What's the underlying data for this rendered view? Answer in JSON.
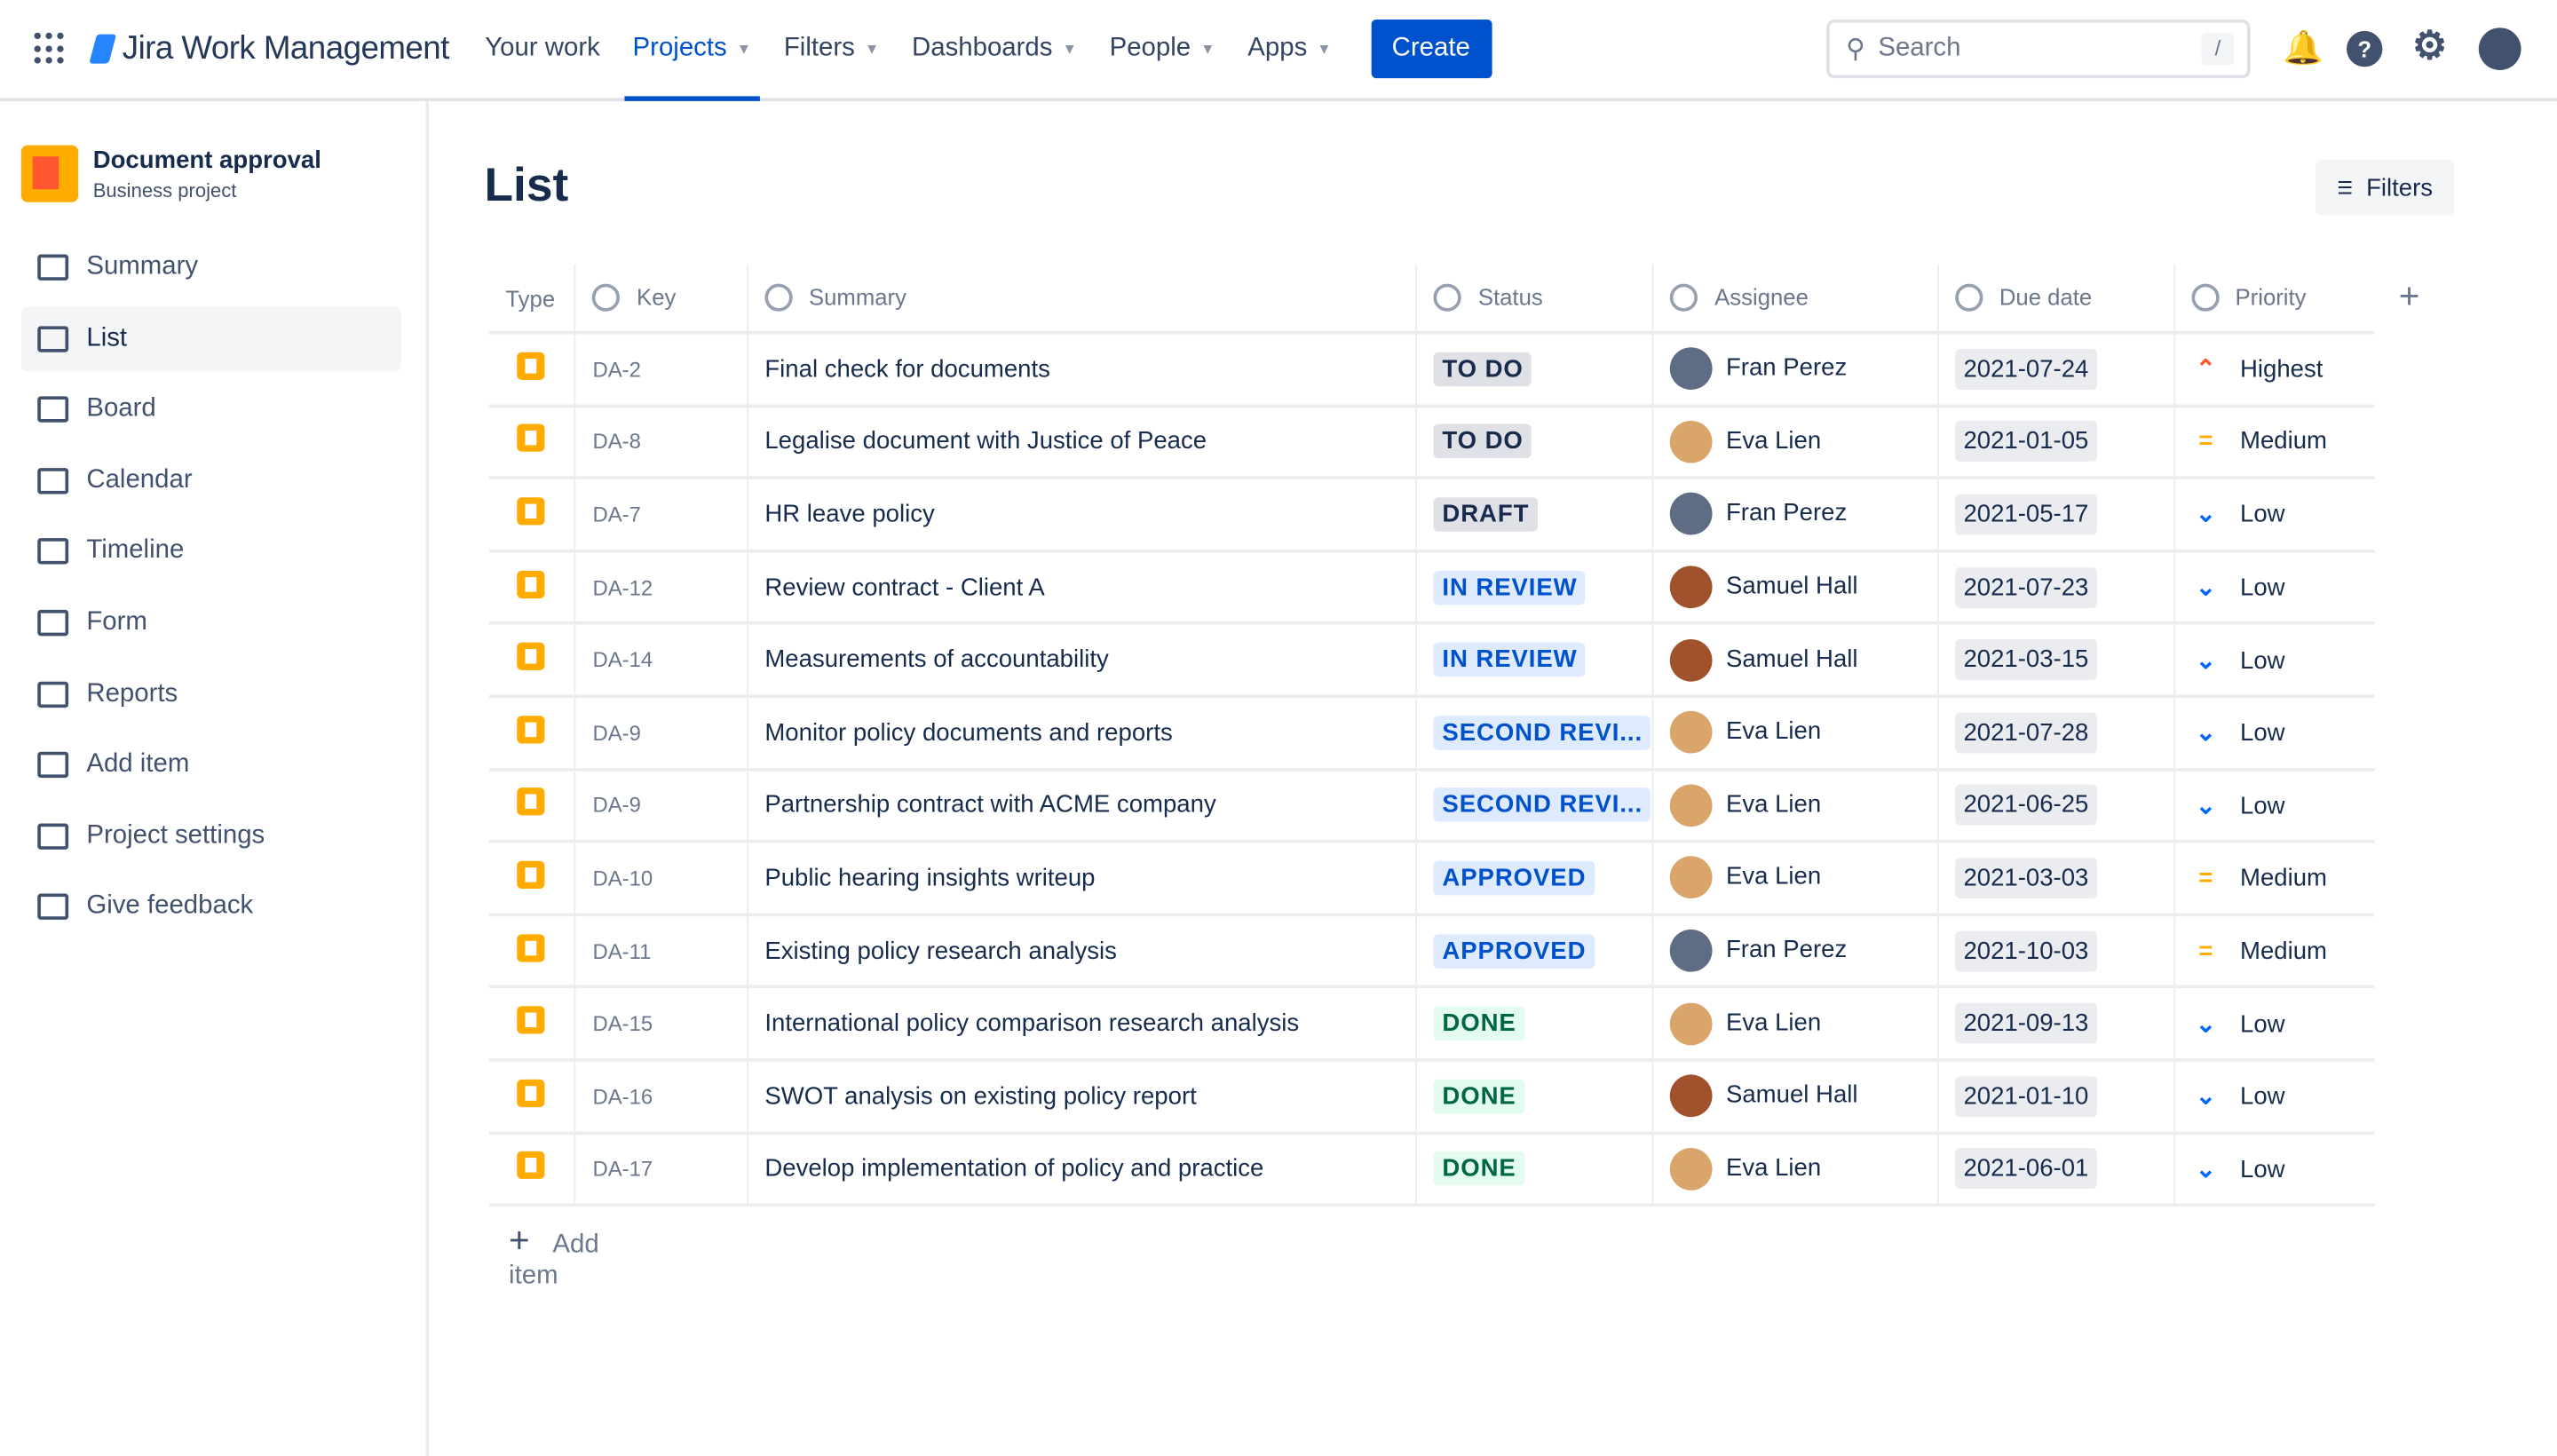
{
  "topbar": {
    "product": "Jira Work Management",
    "nav": [
      {
        "label": "Your work",
        "caret": false
      },
      {
        "label": "Projects",
        "caret": true,
        "active": true
      },
      {
        "label": "Filters",
        "caret": true
      },
      {
        "label": "Dashboards",
        "caret": true
      },
      {
        "label": "People",
        "caret": true
      },
      {
        "label": "Apps",
        "caret": true
      }
    ],
    "create_label": "Create",
    "search_placeholder": "Search",
    "search_shortcut": "/"
  },
  "project": {
    "name": "Document approval",
    "type": "Business project"
  },
  "sidebar": {
    "items": [
      {
        "label": "Summary"
      },
      {
        "label": "List",
        "active": true
      },
      {
        "label": "Board"
      },
      {
        "label": "Calendar"
      },
      {
        "label": "Timeline"
      },
      {
        "label": "Form"
      },
      {
        "label": "Reports"
      },
      {
        "label": "Add item"
      },
      {
        "label": "Project settings"
      },
      {
        "label": "Give feedback"
      }
    ]
  },
  "page": {
    "title": "List",
    "filters_label": "Filters",
    "add_item_label": "Add item"
  },
  "columns": [
    "Type",
    "Key",
    "Summary",
    "Status",
    "Assignee",
    "Due date",
    "Priority"
  ],
  "status_colors": {
    "TO DO": [
      "#dfe1e6",
      "#172b4d"
    ],
    "DRAFT": [
      "#dfe1e6",
      "#172b4d"
    ],
    "IN REVIEW": [
      "#deebff",
      "#0052cc"
    ],
    "SECOND REVI...": [
      "#deebff",
      "#0052cc"
    ],
    "APPROVED": [
      "#deebff",
      "#0052cc"
    ],
    "DONE": [
      "#e3fcef",
      "#006644"
    ]
  },
  "assignee_colors": {
    "Fran Perez": "#5e6c84",
    "Eva Lien": "#d9a56b",
    "Samuel Hall": "#a0522d"
  },
  "priority_icons": {
    "Highest": [
      "⌃",
      "#ff5630"
    ],
    "Medium": [
      "=",
      "#ffab00"
    ],
    "Low": [
      "⌄",
      "#0065ff"
    ]
  },
  "rows": [
    {
      "key": "DA-2",
      "summary": "Final check for documents",
      "status": "TO DO",
      "assignee": "Fran Perez",
      "due": "2021-07-24",
      "priority": "Highest"
    },
    {
      "key": "DA-8",
      "summary": "Legalise document with Justice of Peace",
      "status": "TO DO",
      "assignee": "Eva Lien",
      "due": "2021-01-05",
      "priority": "Medium"
    },
    {
      "key": "DA-7",
      "summary": "HR leave policy",
      "status": "DRAFT",
      "assignee": "Fran Perez",
      "due": "2021-05-17",
      "priority": "Low"
    },
    {
      "key": "DA-12",
      "summary": "Review contract - Client A",
      "status": "IN REVIEW",
      "assignee": "Samuel Hall",
      "due": "2021-07-23",
      "priority": "Low"
    },
    {
      "key": "DA-14",
      "summary": "Measurements of accountability",
      "status": "IN REVIEW",
      "assignee": "Samuel Hall",
      "due": "2021-03-15",
      "priority": "Low"
    },
    {
      "key": "DA-9",
      "summary": "Monitor policy documents and reports",
      "status": "SECOND REVI...",
      "assignee": "Eva Lien",
      "due": "2021-07-28",
      "priority": "Low"
    },
    {
      "key": "DA-9",
      "summary": "Partnership contract with ACME company",
      "status": "SECOND REVI...",
      "assignee": "Eva Lien",
      "due": "2021-06-25",
      "priority": "Low"
    },
    {
      "key": "DA-10",
      "summary": "Public hearing insights writeup",
      "status": "APPROVED",
      "assignee": "Eva Lien",
      "due": "2021-03-03",
      "priority": "Medium"
    },
    {
      "key": "DA-11",
      "summary": "Existing policy research analysis",
      "status": "APPROVED",
      "assignee": "Fran Perez",
      "due": "2021-10-03",
      "priority": "Medium"
    },
    {
      "key": "DA-15",
      "summary": "International policy comparison research analysis",
      "status": "DONE",
      "assignee": "Eva Lien",
      "due": "2021-09-13",
      "priority": "Low"
    },
    {
      "key": "DA-16",
      "summary": "SWOT analysis on existing policy report",
      "status": "DONE",
      "assignee": "Samuel Hall",
      "due": "2021-01-10",
      "priority": "Low"
    },
    {
      "key": "DA-17",
      "summary": "Develop implementation of policy and practice",
      "status": "DONE",
      "assignee": "Eva Lien",
      "due": "2021-06-01",
      "priority": "Low"
    }
  ]
}
